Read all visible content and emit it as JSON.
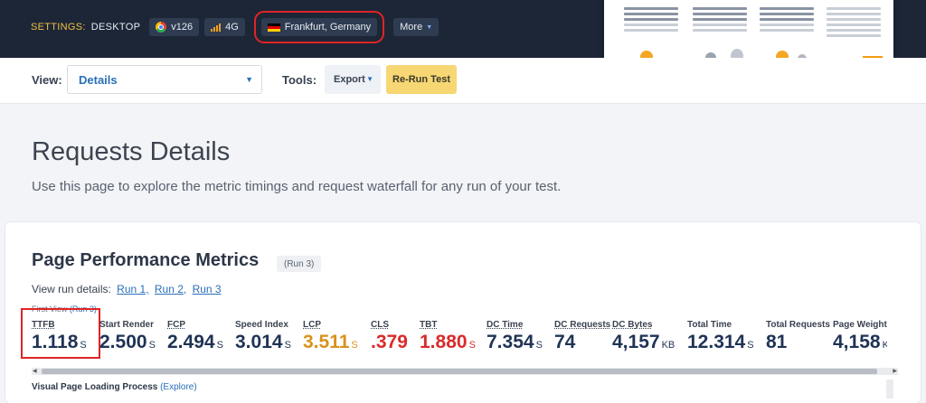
{
  "settings": {
    "label": "SETTINGS:",
    "device": "DESKTOP",
    "browser_version": "v126",
    "browser_icon": "chrome-icon",
    "connection": "4G",
    "connection_icon": "signal-icon",
    "location": "Frankfurt, Germany",
    "location_icon": "germany-flag-icon",
    "more_label": "More"
  },
  "toolbar": {
    "view_label": "View:",
    "view_value": "Details",
    "tools_label": "Tools:",
    "export_label": "Export",
    "rerun_label": "Re-Run Test"
  },
  "page": {
    "title": "Requests Details",
    "subtitle": "Use this page to explore the metric timings and request waterfall for any run of your test."
  },
  "metrics_card": {
    "title": "Page Performance Metrics",
    "run_badge": "(Run 3)",
    "run_details_label": "View run details:",
    "runs": [
      "Run 1,",
      "Run 2,",
      "Run 3"
    ],
    "first_view_label": "First View",
    "first_view_run": "(Run 3)",
    "metrics": [
      {
        "label": "TTFB",
        "value": "1.118",
        "unit": "S",
        "color": "#1f3355"
      },
      {
        "label": "Start Render",
        "value": "2.500",
        "unit": "S",
        "color": "#1f3355"
      },
      {
        "label": "FCP",
        "value": "2.494",
        "unit": "S",
        "color": "#1f3355"
      },
      {
        "label": "Speed Index",
        "value": "3.014",
        "unit": "S",
        "color": "#1f3355"
      },
      {
        "label": "LCP",
        "value": "3.511",
        "unit": "S",
        "color": "#d9921c"
      },
      {
        "label": "CLS",
        "value": ".379",
        "unit": "",
        "color": "#d92b2b"
      },
      {
        "label": "TBT",
        "value": "1.880",
        "unit": "S",
        "color": "#d92b2b"
      },
      {
        "label": "DC Time",
        "value": "7.354",
        "unit": "S",
        "color": "#1f3355"
      },
      {
        "label": "DC Requests",
        "value": "74",
        "unit": "",
        "color": "#1f3355"
      },
      {
        "label": "DC Bytes",
        "value": "4,157",
        "unit": "KB",
        "color": "#1f3355"
      },
      {
        "label": "Total Time",
        "value": "12.314",
        "unit": "S",
        "color": "#1f3355"
      },
      {
        "label": "Total Requests",
        "value": "81",
        "unit": "",
        "color": "#1f3355"
      },
      {
        "label": "Page Weight",
        "value": "4,158",
        "unit": "K",
        "color": "#1f3355"
      }
    ],
    "visual_title": "Visual Page Loading Process",
    "visual_link": "(Explore)"
  }
}
